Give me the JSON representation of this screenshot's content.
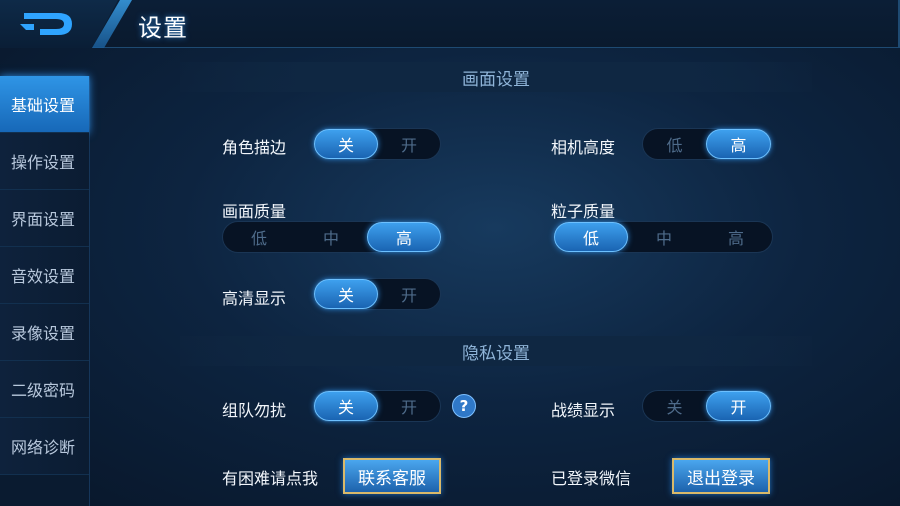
{
  "header": {
    "title": "设置"
  },
  "sidebar": {
    "items": [
      {
        "label": "基础设置",
        "active": true
      },
      {
        "label": "操作设置",
        "active": false
      },
      {
        "label": "界面设置",
        "active": false
      },
      {
        "label": "音效设置",
        "active": false
      },
      {
        "label": "录像设置",
        "active": false
      },
      {
        "label": "二级密码",
        "active": false
      },
      {
        "label": "网络诊断",
        "active": false
      }
    ]
  },
  "display_section": {
    "title": "画面设置",
    "outline": {
      "label": "角色描边",
      "options": [
        "关",
        "开"
      ],
      "selected": "关"
    },
    "camera_height": {
      "label": "相机高度",
      "options": [
        "低",
        "高"
      ],
      "selected": "高"
    },
    "quality": {
      "label": "画面质量",
      "options": [
        "低",
        "中",
        "高"
      ],
      "selected": "高"
    },
    "particle_quality": {
      "label": "粒子质量",
      "options": [
        "低",
        "中",
        "高"
      ],
      "selected": "低"
    },
    "hd_display": {
      "label": "高清显示",
      "options": [
        "关",
        "开"
      ],
      "selected": "关"
    }
  },
  "privacy_section": {
    "title": "隐私设置",
    "team_dnd": {
      "label": "组队勿扰",
      "options": [
        "关",
        "开"
      ],
      "selected": "关"
    },
    "record_display": {
      "label": "战绩显示",
      "options": [
        "关",
        "开"
      ],
      "selected": "开"
    },
    "help_label": "?"
  },
  "support": {
    "label": "有困难请点我",
    "button_label": "联系客服"
  },
  "account": {
    "label": "已登录微信",
    "button_label": "退出登录"
  },
  "colors": {
    "accent": "#2f95e6",
    "button_border": "#d9b96a"
  }
}
